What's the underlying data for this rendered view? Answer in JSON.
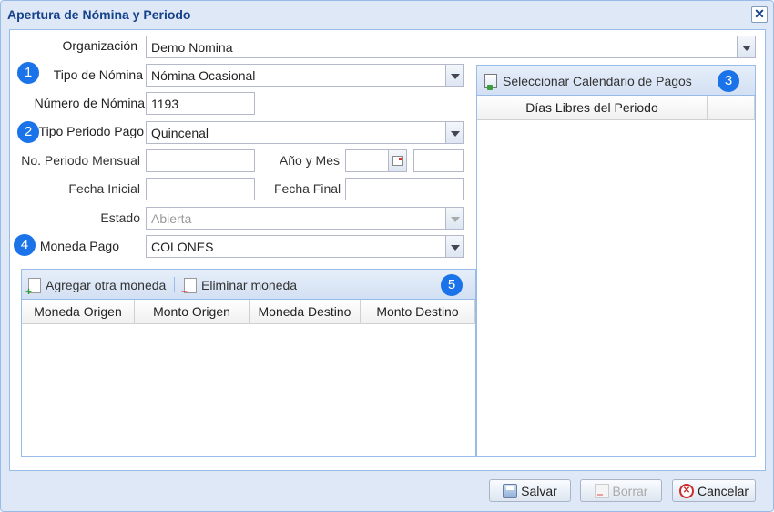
{
  "window": {
    "title": "Apertura de Nómina y Periodo",
    "close_glyph": "✕"
  },
  "form": {
    "organizacion": {
      "label": "Organización",
      "value": "Demo Nomina"
    },
    "tipo_nomina": {
      "label": "Tipo de Nómina",
      "value": "Nómina Ocasional"
    },
    "numero_nomina": {
      "label": "Número de Nómina",
      "value": "1193"
    },
    "tipo_periodo_pago": {
      "label": "Tipo Periodo Pago",
      "value": "Quincenal"
    },
    "no_periodo_mensual": {
      "label": "No. Periodo Mensual",
      "value": ""
    },
    "anio_mes": {
      "label": "Año y Mes",
      "value": ""
    },
    "fecha_inicial": {
      "label": "Fecha Inicial",
      "value": ""
    },
    "fecha_final": {
      "label": "Fecha Final",
      "value": ""
    },
    "estado": {
      "label": "Estado",
      "value": "Abierta"
    },
    "moneda_pago": {
      "label": "Moneda Pago",
      "value": "COLONES"
    }
  },
  "badges": [
    "1",
    "2",
    "3",
    "4",
    "5"
  ],
  "currency_grid": {
    "add_label": "Agregar otra moneda",
    "remove_label": "Eliminar moneda",
    "columns": [
      "Moneda Origen",
      "Monto Origen",
      "Moneda Destino",
      "Monto Destino"
    ],
    "rows": []
  },
  "calendar_grid": {
    "select_label": "Seleccionar Calendario de Pagos",
    "columns": [
      "Días Libres del Periodo",
      ""
    ],
    "rows": []
  },
  "footer": {
    "save": "Salvar",
    "delete": "Borrar",
    "cancel": "Cancelar"
  },
  "icons": {
    "add": "document-plus-icon",
    "remove": "document-minus-icon",
    "calendar": "calendar-icon",
    "save": "floppy-disk-icon",
    "delete": "delete-icon",
    "cancel": "cancel-icon"
  },
  "colors": {
    "window_bg": "#dfe8f6",
    "border": "#99bbe8",
    "title": "#15428b",
    "badge": "#1a73e8"
  }
}
